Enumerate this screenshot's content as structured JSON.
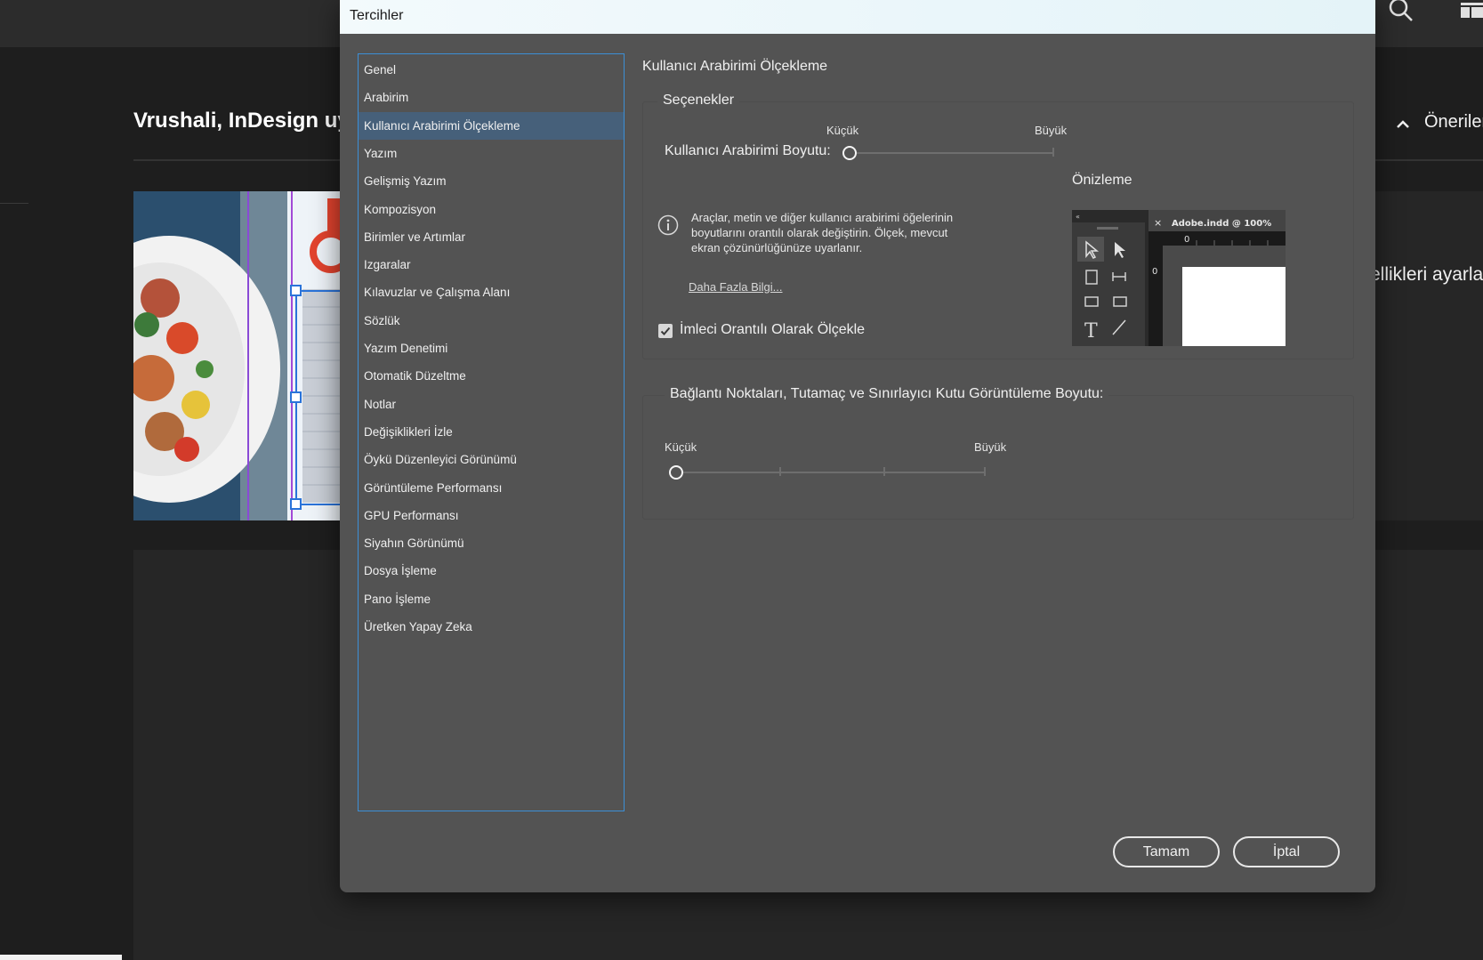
{
  "background": {
    "greeting": "Vrushali, InDesign uygu",
    "suggestions_label": "Önerileri",
    "side_text": "ellikleri ayarlayın"
  },
  "dialog": {
    "title": "Tercihler",
    "nav": {
      "selected_index": 2,
      "items": [
        "Genel",
        "Arabirim",
        "Kullanıcı Arabirimi Ölçekleme",
        "Yazım",
        "Gelişmiş Yazım",
        "Kompozisyon",
        "Birimler ve Artımlar",
        "Izgaralar",
        "Kılavuzlar ve Çalışma Alanı",
        "Sözlük",
        "Yazım Denetimi",
        "Otomatik Düzeltme",
        "Notlar",
        "Değişiklikleri İzle",
        "Öykü Düzenleyici Görünümü",
        "Görüntüleme Performansı",
        "GPU Performansı",
        "Siyahın Görünümü",
        "Dosya İşleme",
        "Pano İşleme",
        "Üretken Yapay Zeka"
      ]
    },
    "section_title": "Kullanıcı Arabirimi Ölçekleme",
    "options": {
      "legend": "Seçenekler",
      "ui_size_label": "Kullanıcı Arabirimi Boyutu:",
      "min_label": "Küçük",
      "max_label": "Büyük",
      "ui_size_value": 0,
      "preview_label": "Önizleme",
      "preview_doc_tab": "Adobe.indd @ 100%",
      "preview_ruler_zero": "0",
      "info_text": "Araçlar, metin ve diğer kullanıcı arabirimi öğelerinin boyutlarını orantılı olarak değiştirin. Ölçek, mevcut ekran çözünürlüğünüze uyarlanır.",
      "learn_more": "Daha Fazla Bilgi...",
      "scale_cursor_label": "İmleci Orantılı Olarak Ölçekle",
      "scale_cursor_checked": true
    },
    "anchor": {
      "legend": "Bağlantı Noktaları, Tutamaç ve Sınırlayıcı Kutu Görüntüleme Boyutu:",
      "min_label": "Küçük",
      "max_label": "Büyük",
      "value": 0
    },
    "buttons": {
      "ok": "Tamam",
      "cancel": "İptal"
    }
  }
}
